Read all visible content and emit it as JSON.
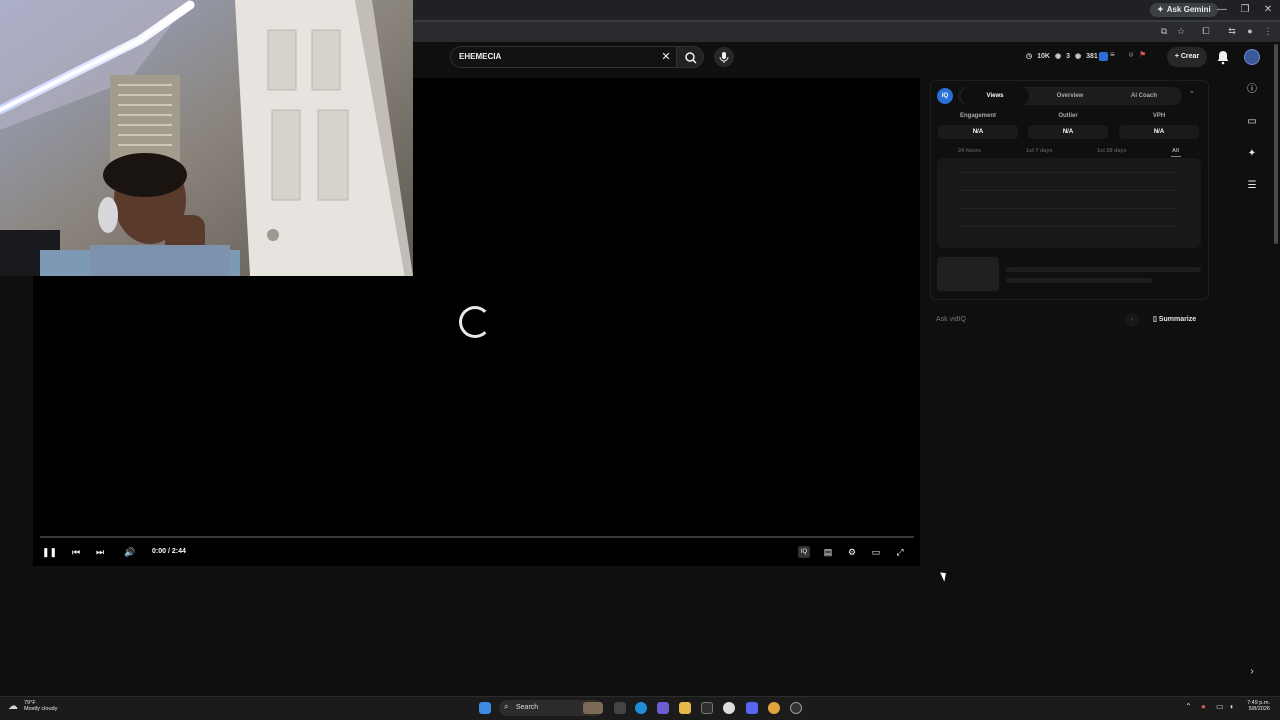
{
  "browser": {
    "gemini_label": "Ask Gemini",
    "window_buttons": [
      "—",
      "❐",
      "✕"
    ]
  },
  "header": {
    "search_query": "EHEMECIA",
    "stats": [
      "10K",
      "3",
      "381"
    ],
    "create_label": "Crear"
  },
  "player": {
    "timecode": "0:00 / 2:44",
    "progress_fraction": 0.0
  },
  "vidiq": {
    "logo_text": "IQ",
    "tabs": [
      "Views",
      "Overview",
      "AI Coach"
    ],
    "active_tab": "Views",
    "metrics": [
      {
        "label": "Engagement",
        "value": "N/A"
      },
      {
        "label": "Outlier",
        "value": "N/A"
      },
      {
        "label": "VPH",
        "value": "N/A"
      }
    ],
    "ranges": [
      "24 hours",
      "1st 7 days",
      "1st 28 days",
      "All"
    ],
    "active_range": "All",
    "ask_placeholder": "Ask vidIQ",
    "summarize_label": "Summarize"
  },
  "taskbar": {
    "weather_temp": "79°F",
    "weather_desc": "Mostly cloudy",
    "search_label": "Search",
    "time": "7:49 p.m.",
    "date": "5/8/2026"
  },
  "colors": {
    "accent_blue": "#2b6fd6",
    "background": "#0f0f0f"
  }
}
